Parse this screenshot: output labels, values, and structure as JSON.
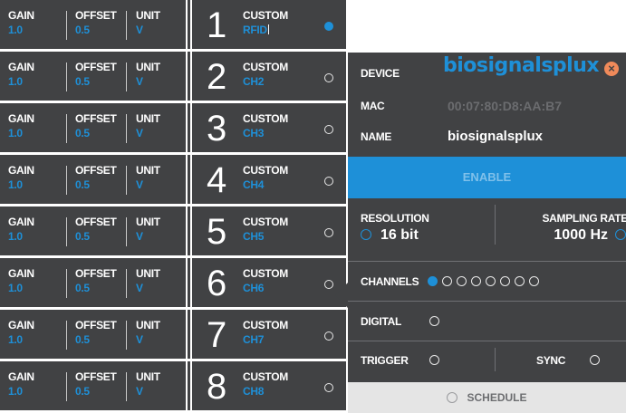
{
  "channels": [
    {
      "gain_label": "GAIN",
      "gain_value": "1.0",
      "offset_label": "OFFSET",
      "offset_value": "0.5",
      "unit_label": "UNIT",
      "unit_value": "V",
      "number": "1",
      "custom_label": "CUSTOM",
      "custom_value": "RFID",
      "selected": true
    },
    {
      "gain_label": "GAIN",
      "gain_value": "1.0",
      "offset_label": "OFFSET",
      "offset_value": "0.5",
      "unit_label": "UNIT",
      "unit_value": "V",
      "number": "2",
      "custom_label": "CUSTOM",
      "custom_value": "CH2",
      "selected": false
    },
    {
      "gain_label": "GAIN",
      "gain_value": "1.0",
      "offset_label": "OFFSET",
      "offset_value": "0.5",
      "unit_label": "UNIT",
      "unit_value": "V",
      "number": "3",
      "custom_label": "CUSTOM",
      "custom_value": "CH3",
      "selected": false
    },
    {
      "gain_label": "GAIN",
      "gain_value": "1.0",
      "offset_label": "OFFSET",
      "offset_value": "0.5",
      "unit_label": "UNIT",
      "unit_value": "V",
      "number": "4",
      "custom_label": "CUSTOM",
      "custom_value": "CH4",
      "selected": false
    },
    {
      "gain_label": "GAIN",
      "gain_value": "1.0",
      "offset_label": "OFFSET",
      "offset_value": "0.5",
      "unit_label": "UNIT",
      "unit_value": "V",
      "number": "5",
      "custom_label": "CUSTOM",
      "custom_value": "CH5",
      "selected": false
    },
    {
      "gain_label": "GAIN",
      "gain_value": "1.0",
      "offset_label": "OFFSET",
      "offset_value": "0.5",
      "unit_label": "UNIT",
      "unit_value": "V",
      "number": "6",
      "custom_label": "CUSTOM",
      "custom_value": "CH6",
      "selected": false
    },
    {
      "gain_label": "GAIN",
      "gain_value": "1.0",
      "offset_label": "OFFSET",
      "offset_value": "0.5",
      "unit_label": "UNIT",
      "unit_value": "V",
      "number": "7",
      "custom_label": "CUSTOM",
      "custom_value": "CH7",
      "selected": false
    },
    {
      "gain_label": "GAIN",
      "gain_value": "1.0",
      "offset_label": "OFFSET",
      "offset_value": "0.5",
      "unit_label": "UNIT",
      "unit_value": "V",
      "number": "8",
      "custom_label": "CUSTOM",
      "custom_value": "CH8",
      "selected": false
    }
  ],
  "device": {
    "device_label": "DEVICE",
    "logo_text": "biosignalsplux",
    "close_icon": "close-icon",
    "mac_label": "MAC",
    "mac_value": "00:07:80:D8:AA:B7",
    "name_label": "NAME",
    "name_value": "biosignalsplux",
    "enable_label": "ENABLE",
    "resolution_label": "RESOLUTION",
    "resolution_value": "16 bit",
    "sampling_rate_label": "SAMPLING RATE",
    "sampling_rate_value": "1000 Hz",
    "channels_label": "CHANNELS",
    "channel_toggles": [
      true,
      false,
      false,
      false,
      false,
      false,
      false,
      false
    ],
    "digital_label": "DIGITAL",
    "trigger_label": "TRIGGER",
    "sync_label": "SYNC",
    "schedule_label": "SCHEDULE"
  },
  "colors": {
    "accent": "#1e90d8",
    "panel_bg": "#414244",
    "close": "#f08a5a"
  }
}
